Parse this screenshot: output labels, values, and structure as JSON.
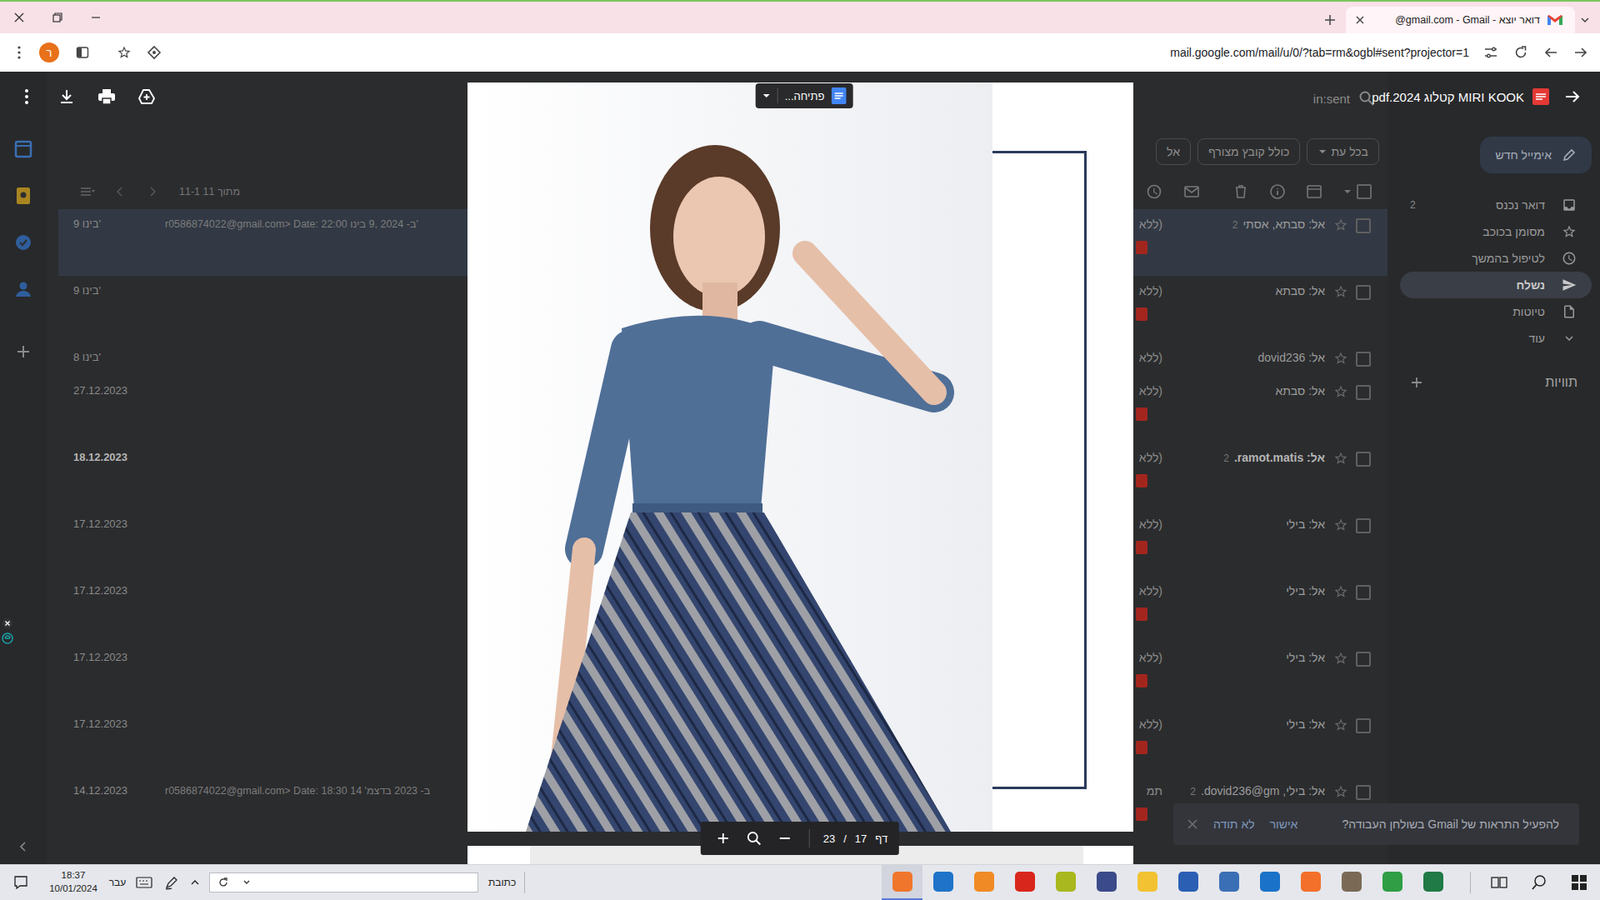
{
  "browser": {
    "tab": {
      "title": "@gmail.com - Gmail - דואר יוצא",
      "selected": true
    },
    "profile": "ר",
    "url": "mail.google.com/mail/u/0/?tab=rm&ogbl#sent?projector=1"
  },
  "viewer": {
    "title": "MIRI KOOK קטלוג 2024.pdf",
    "open_with": "פתיחה...",
    "pager": {
      "label": "דף",
      "current": "17",
      "separator": "/",
      "total": "23"
    }
  },
  "gmail": {
    "search": "in:sent",
    "compose": "אימייל חדש",
    "nav": [
      {
        "label": "דואר נכנס",
        "count": "2",
        "selected": false
      },
      {
        "label": "מסומן בכוכב",
        "selected": false
      },
      {
        "label": "לטיפול בהמשך",
        "selected": false
      },
      {
        "label": "נשלח",
        "selected": true
      },
      {
        "label": "טיוטות",
        "selected": false
      },
      {
        "label": "עוד",
        "selected": false
      }
    ],
    "labels_heading": "תוויות",
    "filters": [
      {
        "label": "בכל עת",
        "dropdown": true
      },
      {
        "label": "כולל קובץ מצורף",
        "dropdown": false
      },
      {
        "label": "אל",
        "dropdown": false
      }
    ],
    "pagination": "11-1 מתוך 11",
    "rows": [
      {
        "recipient": "אל: סבתא, אסתי",
        "count": "2",
        "subject": "(ללא",
        "snippet": "r0586874022@gmail.com> Date: 22:00 ב- 2024 ,9 בינו'",
        "date": "9 בינו'",
        "selected": true,
        "unread": false,
        "attachment": true
      },
      {
        "recipient": "אל: סבתא",
        "subject": "(ללא",
        "date": "9 בינו'",
        "selected": false,
        "unread": false,
        "attachment": true
      },
      {
        "recipient": "אל: dovid236",
        "subject": "(ללא",
        "date": "8 בינו'",
        "selected": false,
        "unread": false,
        "attachment": false
      },
      {
        "recipient": "אל: סבתא",
        "subject": "(ללא",
        "date": "27.12.2023",
        "selected": false,
        "unread": false,
        "attachment": true
      },
      {
        "recipient": "אל: ramot.matis.",
        "count": "2",
        "subject": "(ללא",
        "date": "18.12.2023",
        "selected": false,
        "unread": true,
        "attachment": true
      },
      {
        "recipient": "אל: בילי",
        "subject": "(ללא",
        "date": "17.12.2023",
        "selected": false,
        "unread": false,
        "attachment": true
      },
      {
        "recipient": "אל: בילי",
        "subject": "(ללא",
        "date": "17.12.2023",
        "selected": false,
        "unread": false,
        "attachment": true
      },
      {
        "recipient": "אל: בילי",
        "subject": "(ללא",
        "date": "17.12.2023",
        "selected": false,
        "unread": false,
        "attachment": true
      },
      {
        "recipient": "אל: בילי",
        "subject": "(ללא",
        "date": "17.12.2023",
        "selected": false,
        "unread": false,
        "attachment": true
      },
      {
        "recipient": "אל: בילי, dovid236@gm.",
        "count": "2",
        "subject": "תמ",
        "snippet": "r0586874022@gmail.com> Date: 18:30 ב- 2023 בדצמ' 14",
        "date": "14.12.2023",
        "selected": false,
        "unread": false,
        "attachment": true
      }
    ],
    "toast": {
      "text": "להפעיל התראות של Gmail בשולחן העבודה?",
      "ok": "אישור",
      "dismiss": "לא תודה"
    }
  },
  "taskbar": {
    "time": "18:37",
    "date": "10/01/2024",
    "language": "עבר",
    "address_label": "כתובת",
    "apps": [
      {
        "color": "#f0762c",
        "selected": true
      },
      {
        "color": "#1f74c9",
        "selected": false
      },
      {
        "color": "#f08a24",
        "selected": false
      },
      {
        "color": "#d9261c",
        "selected": false
      },
      {
        "color": "#a9b81e",
        "selected": false
      },
      {
        "color": "#3b4a8a",
        "selected": false
      },
      {
        "color": "#f2c232",
        "selected": false
      },
      {
        "color": "#2b5fb4",
        "selected": false
      },
      {
        "color": "#3b6fb5",
        "selected": false
      },
      {
        "color": "#1a73c8",
        "selected": false
      },
      {
        "color": "#f3702a",
        "selected": false
      },
      {
        "color": "#7a6a55",
        "selected": false
      },
      {
        "color": "#2f9e44",
        "selected": false
      },
      {
        "color": "#1f7a45",
        "selected": false
      }
    ]
  }
}
